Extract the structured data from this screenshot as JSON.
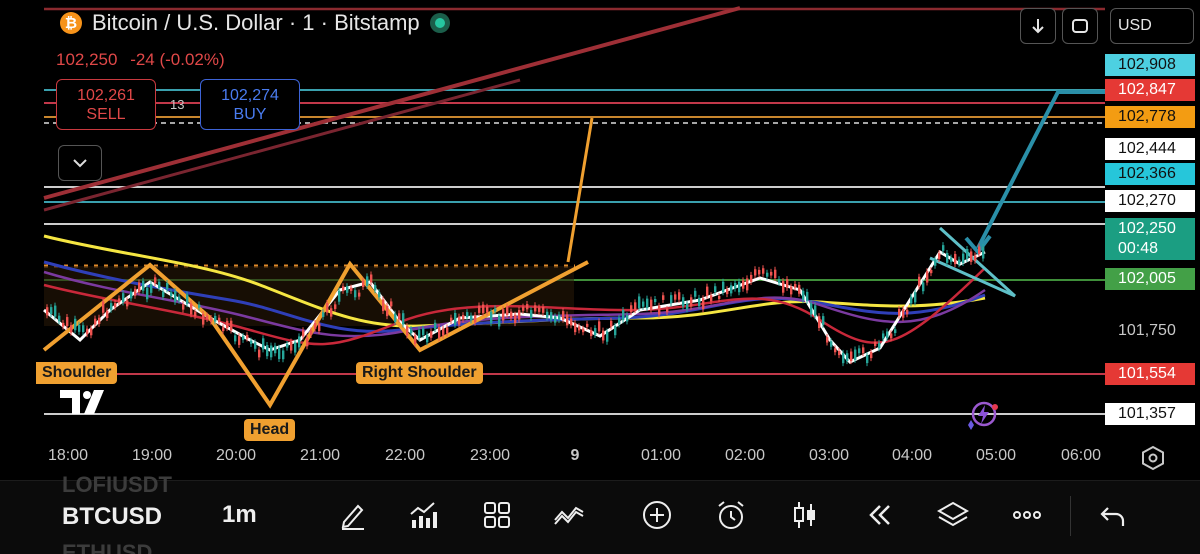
{
  "header": {
    "title": "Bitcoin / U.S. Dollar · 1 · Bitstamp",
    "logo_glyph": "₿",
    "last_price": "102,250",
    "change": "-24 (-0.02%)"
  },
  "trade": {
    "sell_price": "102,261",
    "sell_label": "SELL",
    "buy_price": "102,274",
    "buy_label": "BUY",
    "spread": "13"
  },
  "top_right": {
    "download_icon": "arrow-down-icon",
    "fullscreen_icon": "fullscreen-icon",
    "currency": "USD"
  },
  "price_axis": {
    "labels": [
      {
        "text": "102,908",
        "bg": "#4dd0e1",
        "fg": "#111111"
      },
      {
        "text": "102,847",
        "bg": "#e53935",
        "fg": "#ffffff"
      },
      {
        "text": "102,778",
        "bg": "#f39c12",
        "fg": "#111111"
      },
      {
        "text": "102,444",
        "bg": "#ffffff",
        "fg": "#111111"
      },
      {
        "text": "102,366",
        "bg": "#26c6da",
        "fg": "#111111"
      },
      {
        "text": "102,270",
        "bg": "#ffffff",
        "fg": "#111111"
      },
      {
        "text": "102,005",
        "bg": "#43a047",
        "fg": "#ffffff"
      },
      {
        "text": "101,554",
        "bg": "#e53935",
        "fg": "#ffffff"
      },
      {
        "text": "101,357",
        "bg": "#ffffff",
        "fg": "#111111"
      }
    ],
    "current_price": "102,250",
    "countdown": "00:48",
    "plain_label": "101,750"
  },
  "time_axis": [
    "18:00",
    "19:00",
    "20:00",
    "21:00",
    "22:00",
    "23:00",
    "9",
    "01:00",
    "02:00",
    "03:00",
    "04:00",
    "05:00",
    "06:00"
  ],
  "patterns": {
    "left_shoulder": "Shoulder",
    "head": "Head",
    "right_shoulder": "Right Shoulder"
  },
  "toolbar": {
    "ghost_top": "LOFIUSDT",
    "symbol": "BTCUSD",
    "interval": "1m",
    "ghost_bottom": "ETHUSD"
  },
  "colors": {
    "background": "#000000",
    "up_candle": "#26a69a",
    "down_candle": "#ef5350",
    "pattern_orange": "#f0a030",
    "arrow_teal": "#2a8fa8"
  }
}
